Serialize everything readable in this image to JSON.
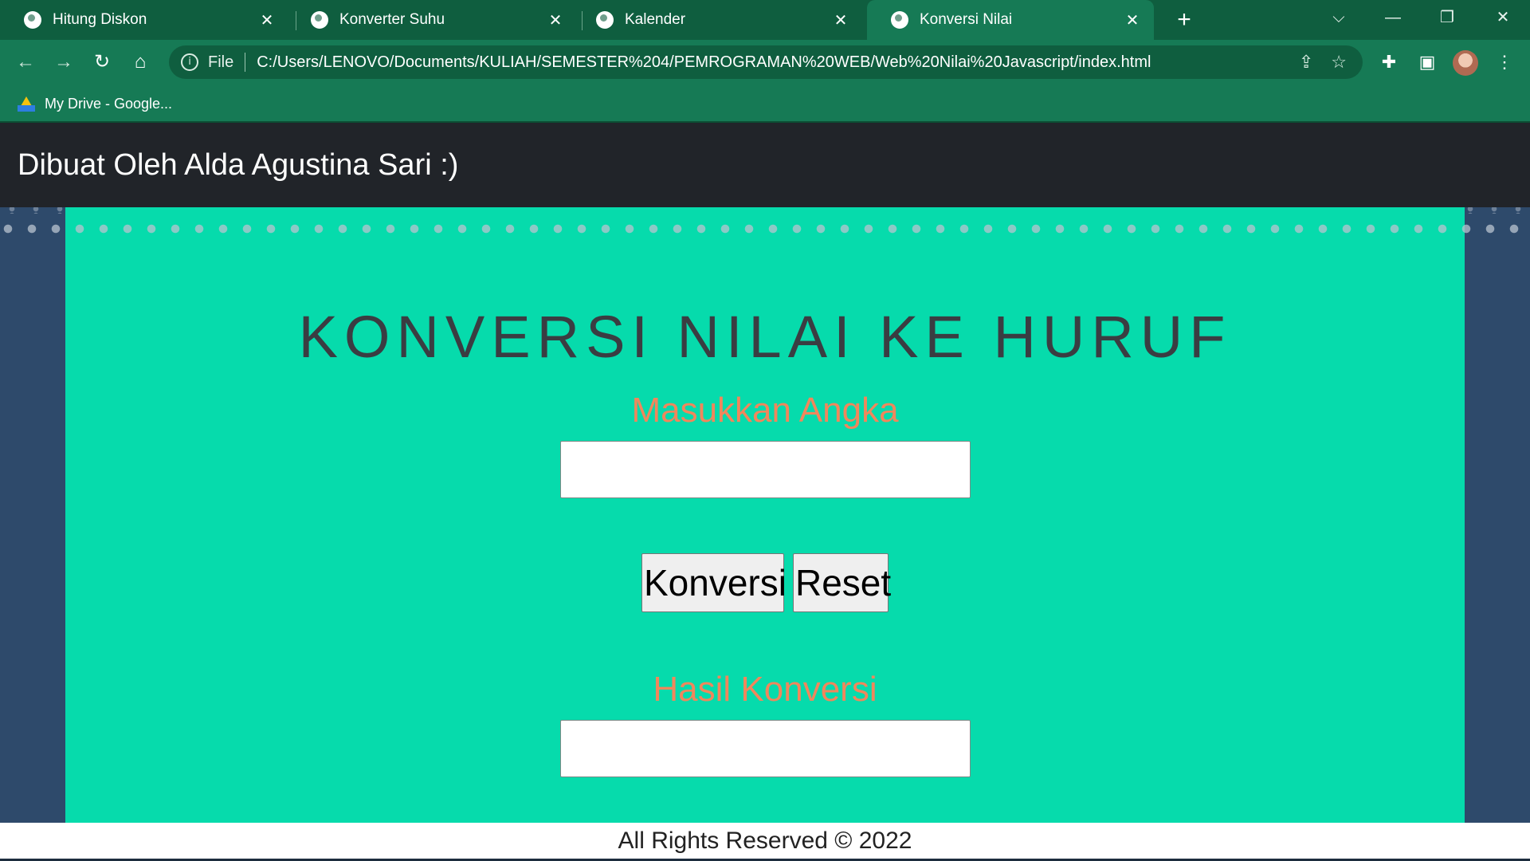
{
  "browser": {
    "tabs": [
      {
        "label": "Hitung Diskon",
        "icon": "globe-icon"
      },
      {
        "label": "Konverter Suhu",
        "icon": "globe-icon"
      },
      {
        "label": "Kalender",
        "icon": "globe-icon"
      },
      {
        "label": "Konversi Nilai",
        "icon": "globe-icon",
        "active": true
      }
    ],
    "close_glyph": "✕",
    "new_tab_glyph": "+",
    "address": {
      "scheme": "File",
      "url": "C:/Users/LENOVO/Documents/KULIAH/SEMESTER%204/PEMROGRAMAN%20WEB/Web%20Nilai%20Javascript/index.html"
    },
    "bookmarks": [
      {
        "label": "My Drive - Google...",
        "icon": "google-drive-icon"
      }
    ]
  },
  "page": {
    "header_title": "Dibuat Oleh Alda Agustina Sari :)",
    "main_title": "KONVERSI NILAI KE HURUF",
    "input_label": "Masukkan Angka",
    "input_value": "",
    "convert_button": "Konversi",
    "reset_button": "Reset",
    "result_label": "Hasil Konversi",
    "result_value": "",
    "footer": "All Rights Reserved © 2022"
  },
  "colors": {
    "chrome_green": "#167a55",
    "header_dark": "#212429",
    "card_teal": "#06dbac",
    "label_orange": "#f0875c",
    "page_navy": "#2e4a6b"
  }
}
